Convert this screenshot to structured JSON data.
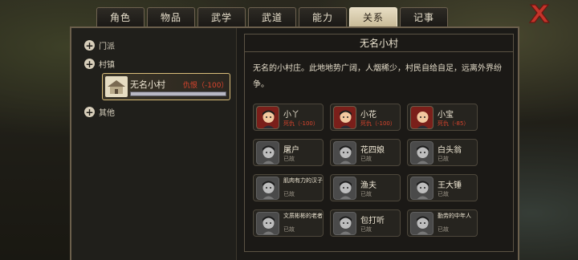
{
  "tabs": [
    {
      "label": "角色",
      "active": false
    },
    {
      "label": "物品",
      "active": false
    },
    {
      "label": "武学",
      "active": false
    },
    {
      "label": "武道",
      "active": false
    },
    {
      "label": "能力",
      "active": false
    },
    {
      "label": "关系",
      "active": true
    },
    {
      "label": "记事",
      "active": false
    }
  ],
  "close_icon": "close-x-icon",
  "tree": {
    "groups": [
      {
        "label": "门派",
        "icon": "expand-plus-icon"
      },
      {
        "label": "村镇",
        "icon": "expand-plus-icon"
      },
      {
        "label": "其他",
        "icon": "expand-plus-icon"
      }
    ],
    "selected_village": {
      "name": "无名小村",
      "relation": "仇恨（-100）",
      "icon": "village-house-icon"
    }
  },
  "panel": {
    "title": "无名小村",
    "description": "无名的小村庄。此地地势广阔，人烟稀少，村民自给自足，远离外界纷争。"
  },
  "npcs": [
    {
      "name": "小丫",
      "status": "死仇（-100）",
      "state": "enemy"
    },
    {
      "name": "小花",
      "status": "死仇（-100）",
      "state": "enemy"
    },
    {
      "name": "小宝",
      "status": "死仇（-85）",
      "state": "enemy"
    },
    {
      "name": "屠户",
      "status": "已故",
      "state": "dead"
    },
    {
      "name": "花四娘",
      "status": "已故",
      "state": "dead"
    },
    {
      "name": "白头翁",
      "status": "已故",
      "state": "dead"
    },
    {
      "name": "肌肉有力的汉子",
      "status": "已故",
      "state": "dead"
    },
    {
      "name": "渔夫",
      "status": "已故",
      "state": "dead"
    },
    {
      "name": "王大锤",
      "status": "已故",
      "state": "dead"
    },
    {
      "name": "文质彬彬的老者",
      "status": "已故",
      "state": "dead"
    },
    {
      "name": "包打听",
      "status": "已故",
      "state": "dead"
    },
    {
      "name": "勤劳的中年人",
      "status": "已故",
      "state": "dead"
    }
  ],
  "colors": {
    "accent_gold": "#d9bd7a",
    "enemy_red": "#d9442d",
    "close_red": "#c4342a"
  }
}
